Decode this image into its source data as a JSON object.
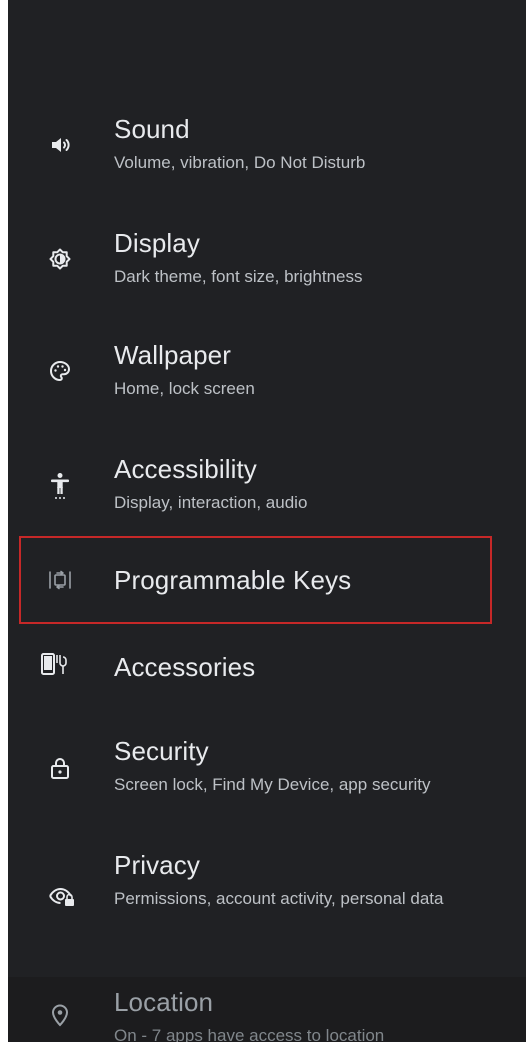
{
  "settings": {
    "items": [
      {
        "title": "Sound",
        "subtitle": "Volume, vibration, Do Not Disturb",
        "icon": "volume-icon"
      },
      {
        "title": "Display",
        "subtitle": "Dark theme, font size, brightness",
        "icon": "brightness-icon"
      },
      {
        "title": "Wallpaper",
        "subtitle": "Home, lock screen",
        "icon": "palette-icon"
      },
      {
        "title": "Accessibility",
        "subtitle": "Display, interaction, audio",
        "icon": "accessibility-icon"
      },
      {
        "title": "Programmable Keys",
        "subtitle": "",
        "icon": "programmable-keys-icon"
      },
      {
        "title": "Accessories",
        "subtitle": "",
        "icon": "accessories-icon"
      },
      {
        "title": "Security",
        "subtitle": "Screen lock, Find My Device, app security",
        "icon": "lock-icon"
      },
      {
        "title": "Privacy",
        "subtitle": "Permissions, account activity, personal data",
        "icon": "privacy-eye-icon"
      },
      {
        "title": "Location",
        "subtitle": "On - 7 apps have access to location",
        "icon": "location-pin-icon"
      }
    ]
  },
  "colors": {
    "background": "#202124",
    "text_primary": "#e8eaed",
    "text_secondary": "#bdc1c6",
    "highlight_border": "#c62828"
  }
}
